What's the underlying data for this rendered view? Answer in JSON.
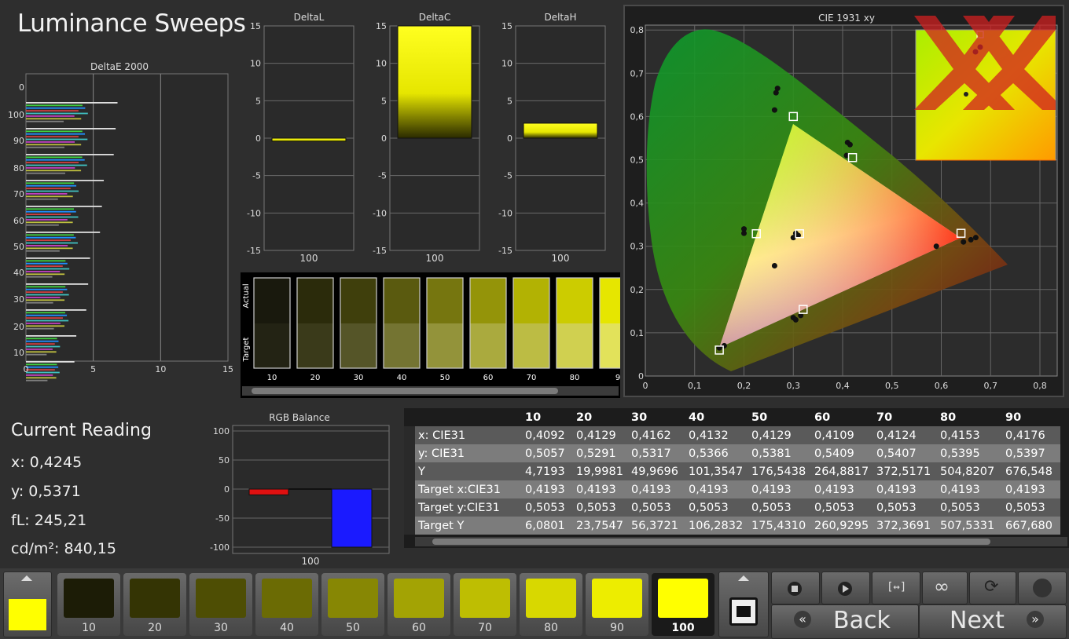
{
  "app": {
    "title": "Luminance Sweeps"
  },
  "deltaE_chart": {
    "title": "DeltaE 2000",
    "x_ticks": [
      "0",
      "5",
      "10",
      "15"
    ],
    "y_ticks": [
      "0",
      "100",
      "90",
      "80",
      "70",
      "60",
      "50",
      "40",
      "30",
      "20",
      "10"
    ]
  },
  "delta_charts": [
    {
      "title": "DeltaL",
      "x_label": "100",
      "value": -0.3,
      "y_ticks": [
        "15",
        "10",
        "5",
        "0",
        "-5",
        "-10",
        "-15"
      ]
    },
    {
      "title": "DeltaC",
      "x_label": "100",
      "value": 15,
      "y_ticks": [
        "15",
        "10",
        "5",
        "0",
        "-5",
        "-10",
        "-15"
      ]
    },
    {
      "title": "DeltaH",
      "x_label": "100",
      "value": 2,
      "y_ticks": [
        "15",
        "10",
        "5",
        "0",
        "-5",
        "-10",
        "-15"
      ]
    }
  ],
  "swatch_strip": {
    "actual_label": "Actual",
    "target_label": "Target",
    "labels": [
      "10",
      "20",
      "30",
      "40",
      "50",
      "60",
      "70",
      "80",
      "9"
    ],
    "actual_colors": [
      "#19190d",
      "#2b2b0b",
      "#3f3f0c",
      "#5a5a0f",
      "#76760f",
      "#949409",
      "#b2b203",
      "#cccc00",
      "#e6e600"
    ],
    "target_colors": [
      "#232314",
      "#3a3a1a",
      "#555528",
      "#747432",
      "#93933a",
      "#aaaa3e",
      "#bcbc44",
      "#d0d050",
      "#e2e25a"
    ]
  },
  "cie_chart": {
    "title": "CIE 1931 xy",
    "x_ticks": [
      "0",
      "0,1",
      "0,2",
      "0,3",
      "0,4",
      "0,5",
      "0,6",
      "0,7",
      "0,8"
    ],
    "y_ticks": [
      "0,8",
      "0,7",
      "0,6",
      "0,5",
      "0,4",
      "0,3",
      "0,2",
      "0,1",
      "0"
    ]
  },
  "rgb_balance": {
    "title": "RGB Balance",
    "x_label": "100",
    "y_ticks": [
      "100",
      "50",
      "0",
      "-50",
      "-100"
    ],
    "values": {
      "red": -10,
      "green": 0,
      "blue": -100
    },
    "colors": {
      "red": "#e01010",
      "blue": "#1a1aff"
    }
  },
  "current_reading": {
    "title": "Current Reading",
    "x": "x: 0,4245",
    "y": "y: 0,5371",
    "fl": "fL: 245,21",
    "cd": "cd/m²: 840,15"
  },
  "table": {
    "headers": [
      "10",
      "20",
      "30",
      "40",
      "50",
      "60",
      "70",
      "80",
      "90"
    ],
    "rows": [
      {
        "label": "x: CIE31",
        "values": [
          "0,4092",
          "0,4129",
          "0,4162",
          "0,4132",
          "0,4129",
          "0,4109",
          "0,4124",
          "0,4153",
          "0,4176"
        ]
      },
      {
        "label": "y: CIE31",
        "values": [
          "0,5057",
          "0,5291",
          "0,5317",
          "0,5366",
          "0,5381",
          "0,5409",
          "0,5407",
          "0,5395",
          "0,5397"
        ]
      },
      {
        "label": "Y",
        "values": [
          "4,7193",
          "19,9981",
          "49,9696",
          "101,3547",
          "176,5438",
          "264,8817",
          "372,5171",
          "504,8207",
          "676,548"
        ]
      },
      {
        "label": "Target x:CIE31",
        "values": [
          "0,4193",
          "0,4193",
          "0,4193",
          "0,4193",
          "0,4193",
          "0,4193",
          "0,4193",
          "0,4193",
          "0,4193"
        ]
      },
      {
        "label": "Target y:CIE31",
        "values": [
          "0,5053",
          "0,5053",
          "0,5053",
          "0,5053",
          "0,5053",
          "0,5053",
          "0,5053",
          "0,5053",
          "0,5053"
        ]
      },
      {
        "label": "Target Y",
        "values": [
          "6,0801",
          "23,7547",
          "56,3721",
          "106,2832",
          "175,4310",
          "260,9295",
          "372,3691",
          "507,5331",
          "667,680"
        ]
      }
    ]
  },
  "bottom_swatches": {
    "current_color": "#ffff00",
    "items": [
      {
        "label": "10",
        "color": "#1c1c06"
      },
      {
        "label": "20",
        "color": "#343404"
      },
      {
        "label": "30",
        "color": "#4e4e04"
      },
      {
        "label": "40",
        "color": "#6b6b04"
      },
      {
        "label": "50",
        "color": "#878704"
      },
      {
        "label": "60",
        "color": "#a3a304"
      },
      {
        "label": "70",
        "color": "#bebe02"
      },
      {
        "label": "80",
        "color": "#d8d800"
      },
      {
        "label": "90",
        "color": "#eded00"
      },
      {
        "label": "100",
        "color": "#ffff00"
      }
    ]
  },
  "nav": {
    "back": "Back",
    "next": "Next"
  }
}
